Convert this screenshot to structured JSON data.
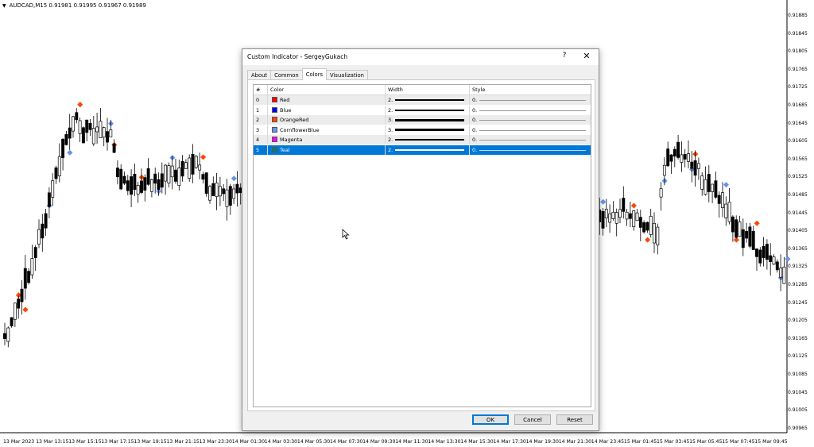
{
  "chart": {
    "symbol_header": "AUDCAD,M15  0.91981 0.91995 0.91967 0.91989",
    "y_axis_labels": [
      "0.91885",
      "0.91845",
      "0.91805",
      "0.91765",
      "0.91725",
      "0.91685",
      "0.91645",
      "0.91605",
      "0.91565",
      "0.91525",
      "0.91485",
      "0.91445",
      "0.91405",
      "0.91365",
      "0.91325",
      "0.91285",
      "0.91245",
      "0.91205",
      "0.91165",
      "0.91125",
      "0.91085",
      "0.91045",
      "0.91005",
      "0.90965"
    ],
    "x_axis_labels": [
      "13 Mar 2023",
      "13 Mar 13:15",
      "13 Mar 15:15",
      "13 Mar 17:15",
      "13 Mar 19:15",
      "13 Mar 21:15",
      "13 Mar 23:30",
      "14 Mar 01:30",
      "14 Mar 03:30",
      "14 Mar 05:30",
      "14 Mar 07:30",
      "14 Mar 09:30",
      "14 Mar 11:30",
      "14 Mar 13:30",
      "14 Mar 15:30",
      "14 Mar 17:30",
      "14 Mar 19:30",
      "14 Mar 21:30",
      "14 Mar 23:45",
      "15 Mar 01:45",
      "15 Mar 03:45",
      "15 Mar 05:45",
      "15 Mar 07:45",
      "15 Mar 09:45"
    ],
    "marker_colors": {
      "orange": "#ff4500",
      "blue": "#6495ed"
    }
  },
  "dialog": {
    "title": "Custom Indicator - SergeyGukach",
    "help_label": "?",
    "close_label": "✕",
    "tabs": [
      "About",
      "Common",
      "Colors",
      "Visualization"
    ],
    "active_tab": "Colors",
    "columns": {
      "index": "#",
      "color": "Color",
      "width": "Width",
      "style": "Style"
    },
    "rows": [
      {
        "index": "0",
        "color_name": "Red",
        "hex": "#ff0000",
        "width": "2.",
        "style": "0."
      },
      {
        "index": "1",
        "color_name": "Blue",
        "hex": "#0000ff",
        "width": "2.",
        "style": "0."
      },
      {
        "index": "2",
        "color_name": "OrangeRed",
        "hex": "#ff4500",
        "width": "3.",
        "style": "0."
      },
      {
        "index": "3",
        "color_name": "CornflowerBlue",
        "hex": "#6495ed",
        "width": "3.",
        "style": "0."
      },
      {
        "index": "4",
        "color_name": "Magenta",
        "hex": "#ff00ff",
        "width": "2.",
        "style": "0."
      },
      {
        "index": "5",
        "color_name": "Teal",
        "hex": "#008080",
        "width": "2.",
        "style": "0."
      }
    ],
    "selected_row": 5,
    "buttons": {
      "ok": "OK",
      "cancel": "Cancel",
      "reset": "Reset"
    }
  }
}
